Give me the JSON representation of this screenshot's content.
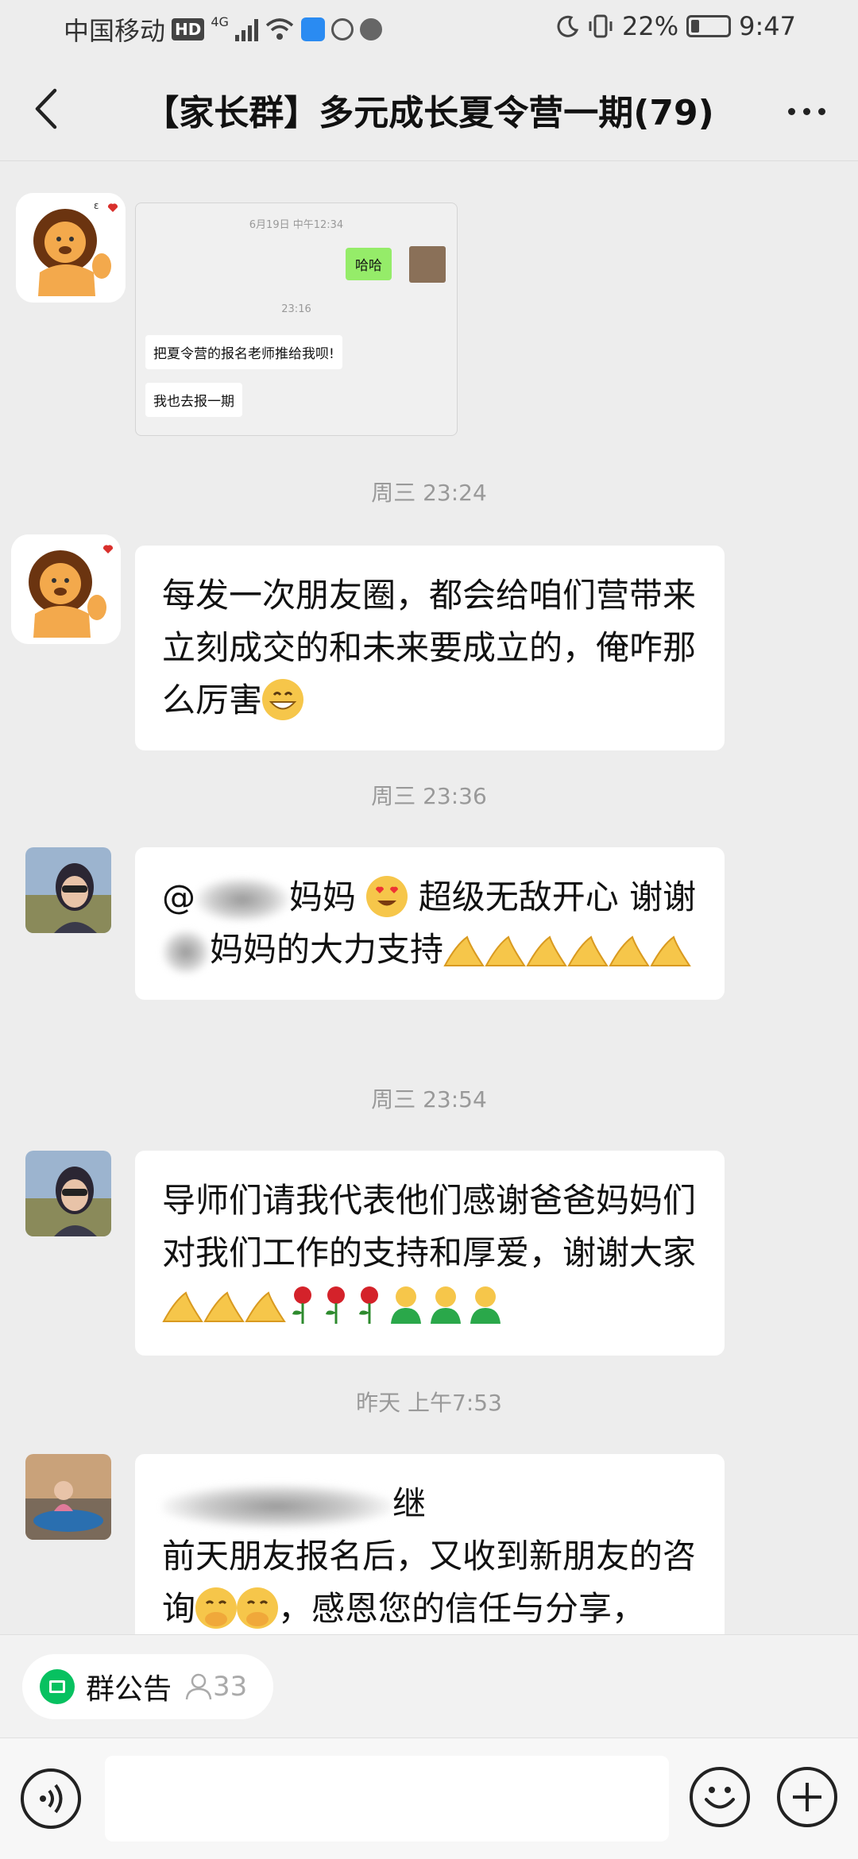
{
  "status_bar": {
    "carrier": "中国移动",
    "hd": "HD",
    "network": "4G",
    "battery": "22%",
    "time": "9:47"
  },
  "header": {
    "title": "【家长群】多元成长夏令营一期(79)"
  },
  "messages": {
    "m1": {
      "type": "image",
      "ts1": "6月19日 中午12:34",
      "green": "哈哈",
      "ts2": "23:16",
      "white1": "把夏令营的报名老师推给我呗!",
      "white2": "我也去报一期"
    },
    "t1": "周三 23:24",
    "m2": {
      "text": "每发一次朋友圈，都会给咱们营带来立刻成交的和未来要成立的，俺咋那么厉害"
    },
    "t2": "周三 23:36",
    "m3": {
      "part1": "@",
      "part2": "妈妈",
      "part3": "超级无敌开心 谢谢",
      "part4": "妈妈的大力支持"
    },
    "t3": "周三 23:54",
    "m4": {
      "text": "导师们请我代表他们感谢爸爸妈妈们对我们工作的支持和厚爱，谢谢大家"
    },
    "t4": "昨天 上午7:53",
    "m5": {
      "part1": "继",
      "part2": "前天朋友报名后，又收到新朋友的咨询",
      "part3": "，感恩您的信任与分享，"
    }
  },
  "announcement": {
    "label": "群公告",
    "count": "33"
  },
  "input": {
    "placeholder": ""
  }
}
